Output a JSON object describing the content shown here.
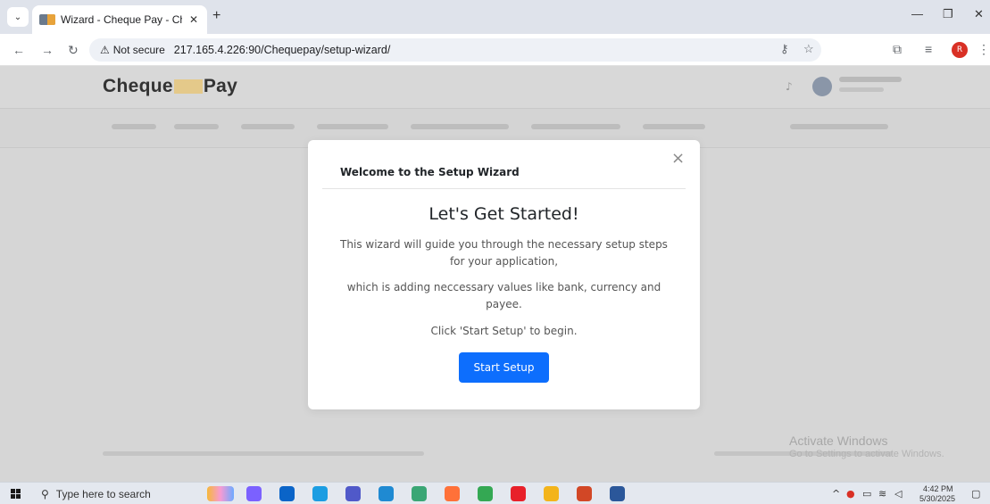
{
  "browser": {
    "tab_title": "Wizard - Cheque Pay - Cheque",
    "tab_close": "✕",
    "new_tab": "+",
    "not_secure": "Not secure",
    "url": "217.165.4.226:90/Chequepay/setup-wizard/",
    "profile_initial": "R"
  },
  "app": {
    "brand_left": "Cheque",
    "brand_right": "Pay"
  },
  "modal": {
    "title": "Welcome to the Setup Wizard",
    "close": "×",
    "heading": "Let's Get Started!",
    "paragraph_1": "This wizard will guide you through the necessary setup steps for your application,",
    "paragraph_2": "which is adding neccessary values like bank, currency and payee.",
    "paragraph_3": "Click 'Start Setup' to begin.",
    "start_button": "Start Setup"
  },
  "watermark": {
    "title": "Activate Windows",
    "subtitle": "Go to Settings to activate Windows."
  },
  "taskbar": {
    "search_placeholder": "Type here to search",
    "time": "4:42 PM",
    "date": "5/30/2025",
    "apps": [
      {
        "name": "copilot-app",
        "color": "#7b61ff"
      },
      {
        "name": "outlook-app",
        "color": "#0a64c8"
      },
      {
        "name": "edge-app",
        "color": "#1b9de2"
      },
      {
        "name": "teams-app",
        "color": "#5059c9"
      },
      {
        "name": "vscode-app",
        "color": "#1f8ad2"
      },
      {
        "name": "app-green",
        "color": "#3aa675"
      },
      {
        "name": "firefox-app",
        "color": "#ff7139"
      },
      {
        "name": "chrome-app",
        "color": "#34a853"
      },
      {
        "name": "media-app",
        "color": "#e8202a"
      },
      {
        "name": "file-explorer-app",
        "color": "#f3b41b"
      },
      {
        "name": "powerpoint-app",
        "color": "#d24726"
      },
      {
        "name": "word-app",
        "color": "#2b579a"
      }
    ]
  },
  "colors": {
    "primary": "#0d6efd",
    "backdrop": "#d6d6d6"
  }
}
